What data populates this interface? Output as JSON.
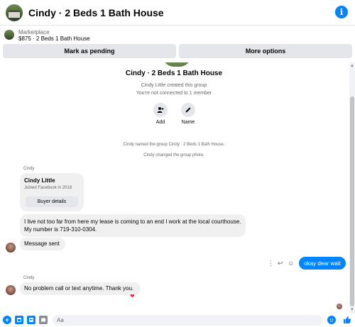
{
  "header": {
    "title": "Cindy · 2 Beds 1 Bath House",
    "info_icon": "i"
  },
  "listing": {
    "label": "Marketplace",
    "price_title": "$875 · 2 Beds 1 Bath House",
    "mark_pending_label": "Mark as pending",
    "more_options_label": "More options"
  },
  "group": {
    "title": "Cindy · 2 Beds 1 Bath House",
    "created_by": "Cindy Little created this group",
    "connection": "You're not connected to 1 member",
    "add_label": "Add",
    "name_label": "Name"
  },
  "system_messages": [
    "Cindy named the group Cindy · 2 Beds 1 Bath House.",
    "Cindy changed the group photo."
  ],
  "messages": {
    "sender_1": "Cindy",
    "profile_card": {
      "name": "Cindy Little",
      "joined": "Joined Facebook in 2018",
      "button": "Buyer details"
    },
    "msg_1": "I live not too far from here my lease is coming to an end I work at the local courthouse. My number is 719-310-0304.",
    "msg_2": "Message sent",
    "reply": "okay dear wait",
    "sender_2": "Cindy",
    "msg_3": "No problem call or text anytime. Thank you.",
    "reaction": "❤"
  },
  "composer": {
    "placeholder": "Aa"
  },
  "colors": {
    "accent": "#0084ff",
    "bubble_grey": "#f0f0f0",
    "button_grey": "#e4e6eb"
  },
  "icons": {
    "info": "info-icon",
    "add": "add-person-icon",
    "name": "pencil-icon",
    "more": "more-icon",
    "reply": "reply-icon",
    "react": "smile-icon",
    "composer_plus": "plus-icon",
    "composer_sticker": "sticker-icon",
    "composer_gif": "gif-icon",
    "composer_image": "image-icon",
    "emoji": "emoji-icon",
    "like": "thumbs-up-icon"
  }
}
